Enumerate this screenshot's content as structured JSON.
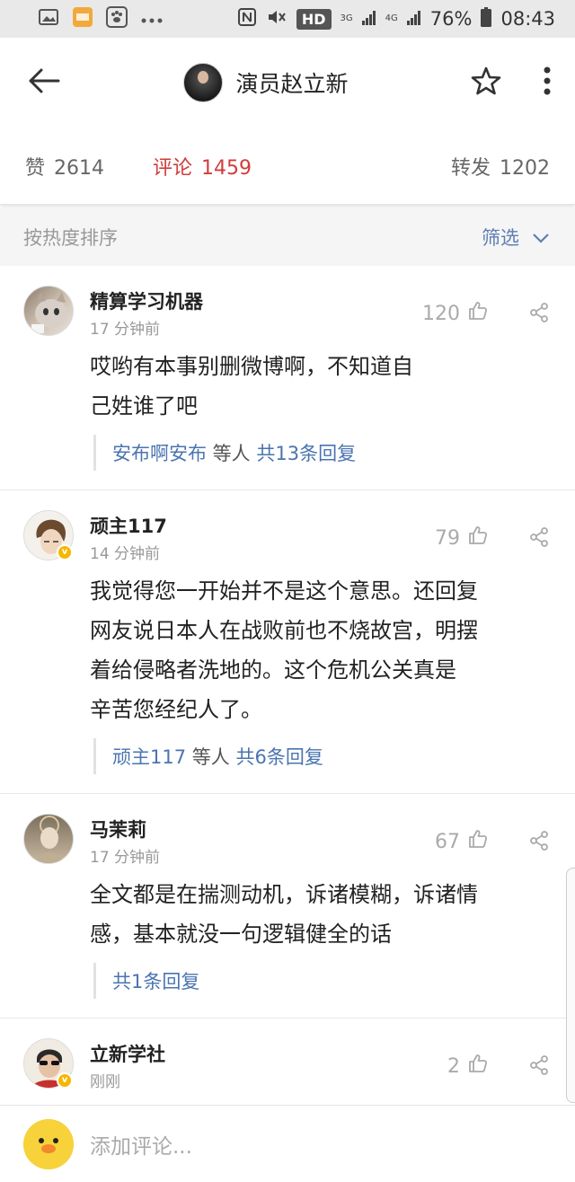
{
  "status_bar": {
    "battery": "76%",
    "time": "08:43",
    "hd": "HD",
    "net1": "3G",
    "net2": "4G"
  },
  "header": {
    "title": "演员赵立新"
  },
  "stats": {
    "like_label": "赞",
    "like_count": "2614",
    "comment_label": "评论",
    "comment_count": "1459",
    "repost_label": "转发",
    "repost_count": "1202"
  },
  "filter": {
    "sort_label": "按热度排序",
    "filter_label": "筛选"
  },
  "comments": [
    {
      "name": "精算学习机器",
      "time": "17 分钟前",
      "likes": "120",
      "text_lines": [
        "哎哟有本事别删微博啊，不知道自",
        "己姓谁了吧"
      ],
      "reply_user": "安布啊安布",
      "reply_mid": " 等人 ",
      "reply_count": "共13条回复"
    },
    {
      "name": "顽主117",
      "time": "14 分钟前",
      "likes": "79",
      "text_lines": [
        "我觉得您一开始并不是这个意思。还回复",
        "网友说日本人在战败前也不烧故宫，明摆",
        "着给侵略者洗地的。这个危机公关真是",
        "辛苦您经纪人了。"
      ],
      "reply_user": "顽主117",
      "reply_mid": " 等人 ",
      "reply_count": "共6条回复"
    },
    {
      "name": "马茉莉",
      "time": "17 分钟前",
      "likes": "67",
      "text_lines": [
        "全文都是在揣测动机，诉诸模糊，诉诸情",
        "感，基本就没一句逻辑健全的话"
      ],
      "reply_count": "共1条回复"
    },
    {
      "name": "立新学社",
      "time": "刚刚",
      "likes": "2"
    }
  ],
  "bottom": {
    "placeholder": "添加评论..."
  },
  "colors": {
    "accent_red": "#d13c3c",
    "link_blue": "#4a74b0"
  }
}
